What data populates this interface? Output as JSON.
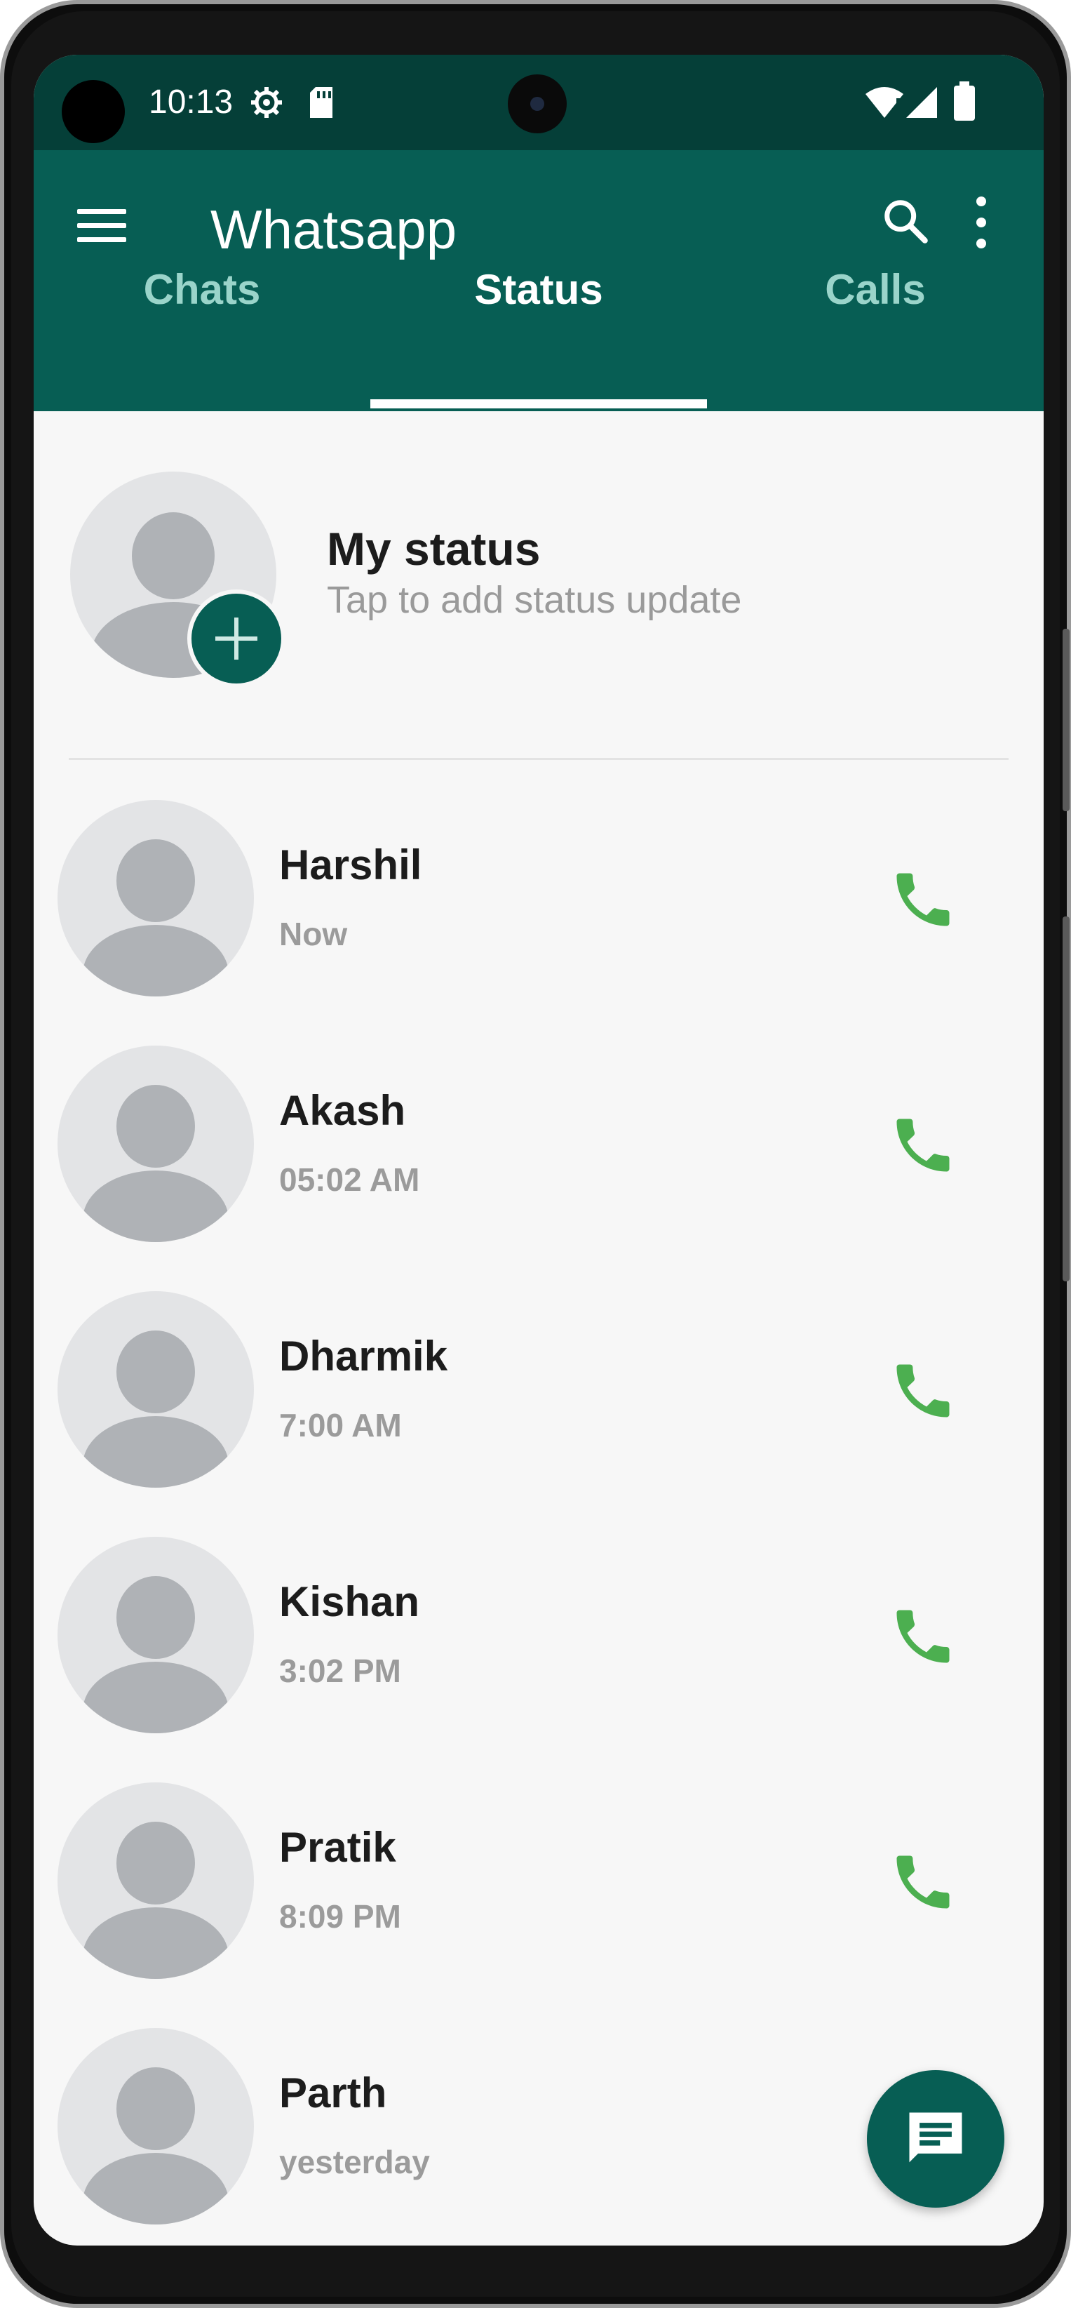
{
  "status_bar": {
    "time": "10:13",
    "icons": [
      "settings-icon",
      "sd-card-icon",
      "wifi-alert-icon",
      "signal-icon",
      "battery-icon"
    ]
  },
  "app_bar": {
    "title": "Whatsapp",
    "icons": [
      "menu-icon",
      "search-icon",
      "more-vert-icon"
    ],
    "background": "#075e54"
  },
  "tabs": [
    {
      "label": "Chats",
      "active": false
    },
    {
      "label": "Status",
      "active": true
    },
    {
      "label": "Calls",
      "active": false
    }
  ],
  "my_status": {
    "title": "My status",
    "subtitle": "Tap to add status update"
  },
  "contacts": [
    {
      "name": "Harshil",
      "time": "Now"
    },
    {
      "name": "Akash",
      "time": "05:02 AM"
    },
    {
      "name": "Dharmik",
      "time": "7:00 AM"
    },
    {
      "name": "Kishan",
      "time": "3:02 PM"
    },
    {
      "name": "Pratik",
      "time": "8:09 PM"
    },
    {
      "name": "Parth",
      "time": "yesterday"
    }
  ],
  "colors": {
    "accent": "#075e54",
    "status_bar": "#053f38",
    "call_icon": "#4caf50",
    "inactive_tab": "#9ad4ca"
  },
  "fab_icon": "message-icon"
}
